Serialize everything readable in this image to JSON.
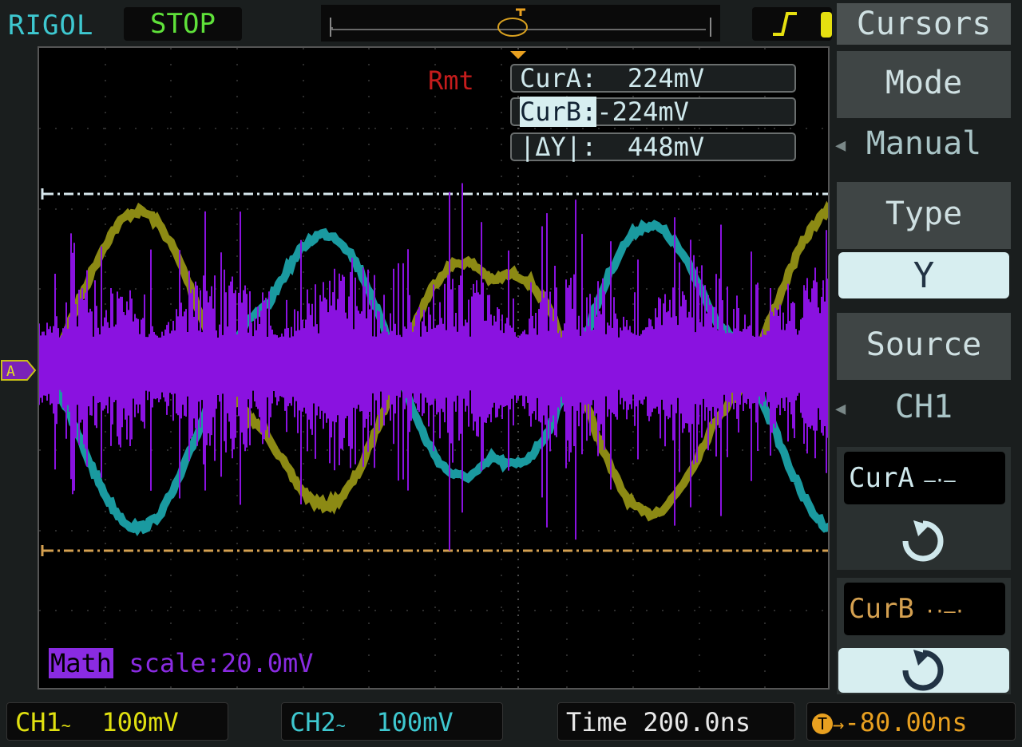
{
  "header": {
    "brand": "RIGOL",
    "status": "STOP"
  },
  "readout": {
    "rmt": "Rmt",
    "cur_a": "CurA:  224mV",
    "cur_b_label": "CurB:",
    "cur_b_value": "-224mV",
    "delta_y": "|ΔY|:  448mV"
  },
  "math": {
    "tag": "Math",
    "scale": "scale:20.0mV"
  },
  "menu": {
    "title": "Cursors",
    "mode_label": "Mode",
    "mode_value": "Manual",
    "type_label": "Type",
    "type_value": "Y",
    "source_label": "Source",
    "source_value": "CH1",
    "cur_a_label": "CurA",
    "cur_b_label": "CurB"
  },
  "footer": {
    "ch1": "CH1",
    "ch1_scale": "100mV",
    "ch2": "CH2",
    "ch2_scale": "100mV",
    "time_label": "Time",
    "time_value": "200.0ns",
    "trig_offset": "-80.00ns"
  },
  "colors": {
    "ch1": "#8c8a14",
    "ch2": "#1a9aa0",
    "math": "#8a12e0",
    "cursor_a": "#d8e8ee",
    "cursor_b": "#d4a050"
  }
}
